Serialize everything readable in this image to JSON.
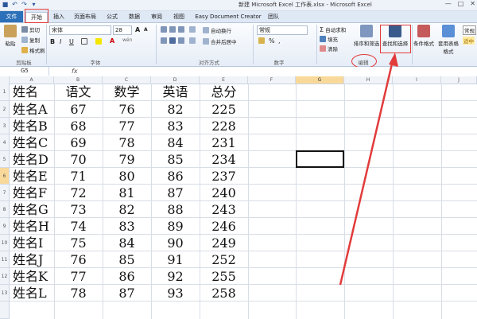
{
  "window": {
    "title": "新建 Microsoft Excel 工作表.xlsx - Microsoft Excel",
    "controls": [
      "—",
      "□",
      "✕"
    ]
  },
  "tabs": [
    "文件",
    "开始",
    "插入",
    "页面布局",
    "公式",
    "数据",
    "审阅",
    "视图",
    "Easy Document Creator",
    "团队"
  ],
  "ribbon": {
    "clipboard": {
      "paste": "粘贴",
      "cut": "剪切",
      "copy": "复制",
      "format_painter": "格式刷",
      "label": "剪贴板"
    },
    "font": {
      "name": "宋体",
      "size": "28",
      "grow": "A",
      "shrink": "A",
      "bold": "B",
      "italic": "I",
      "underline": "U",
      "font_color_glyph": "A",
      "wen": "wén",
      "label": "字体"
    },
    "alignment": {
      "wrap_text": "自动换行",
      "merge_center": "合并后居中",
      "label": "对齐方式"
    },
    "number": {
      "format": "常规",
      "currency": "%",
      "comma": ",",
      "label": "数字"
    },
    "editing": {
      "autosum": "自动求和",
      "fill": "填充",
      "clear": "清除",
      "sort_filter": "排序和筛选",
      "find_select": "查找和选择",
      "label": "编辑"
    },
    "styles": {
      "conditional_format": "条件格式",
      "table_format": "套用表格格式",
      "normal": "常规",
      "good": "适中"
    }
  },
  "formula_bar": {
    "name_box": "G5",
    "fx": "fx"
  },
  "columns": [
    "A",
    "B",
    "C",
    "D",
    "E",
    "F",
    "G",
    "H",
    "I",
    "J"
  ],
  "rows": [
    "1",
    "2",
    "3",
    "4",
    "5",
    "6",
    "7",
    "8",
    "9",
    "10",
    "11",
    "12",
    "13"
  ],
  "selected_cell": "G6",
  "table": {
    "headers": [
      "姓名",
      "语文",
      "数学",
      "英语",
      "总分"
    ],
    "data": [
      [
        "姓名A",
        "67",
        "76",
        "82",
        "225"
      ],
      [
        "姓名B",
        "68",
        "77",
        "83",
        "228"
      ],
      [
        "姓名C",
        "69",
        "78",
        "84",
        "231"
      ],
      [
        "姓名D",
        "70",
        "79",
        "85",
        "234"
      ],
      [
        "姓名E",
        "71",
        "80",
        "86",
        "237"
      ],
      [
        "姓名F",
        "72",
        "81",
        "87",
        "240"
      ],
      [
        "姓名G",
        "73",
        "82",
        "88",
        "243"
      ],
      [
        "姓名H",
        "74",
        "83",
        "89",
        "246"
      ],
      [
        "姓名I",
        "75",
        "84",
        "90",
        "249"
      ],
      [
        "姓名J",
        "76",
        "85",
        "91",
        "252"
      ],
      [
        "姓名K",
        "77",
        "86",
        "92",
        "255"
      ],
      [
        "姓名L",
        "78",
        "87",
        "93",
        "258"
      ]
    ]
  },
  "colors": {
    "annotation_red": "#e23b3b",
    "file_tab_blue": "#2b70b8",
    "selected_header": "#f9d99a"
  }
}
